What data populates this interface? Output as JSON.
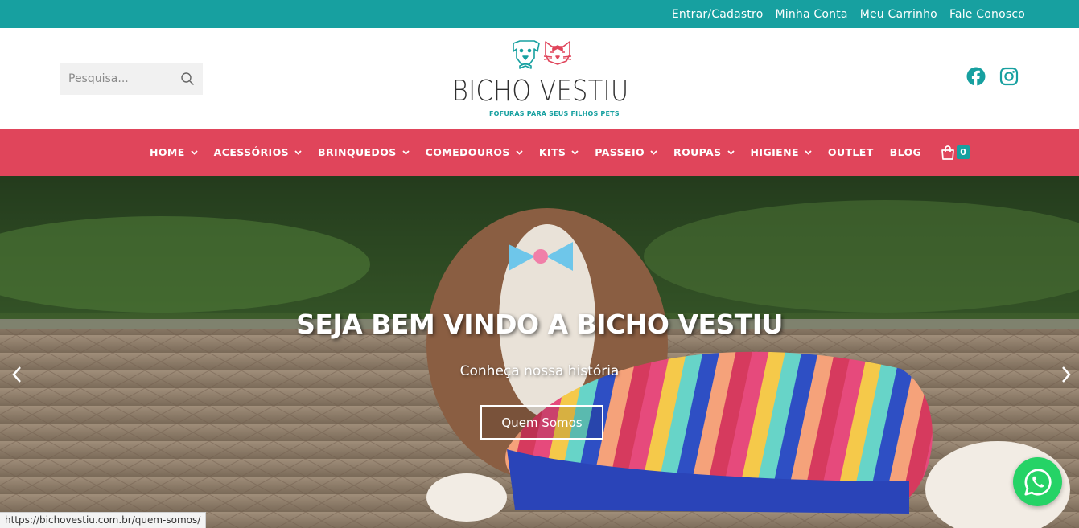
{
  "topbar": {
    "links": [
      "Entrar/Cadastro",
      "Minha Conta",
      "Meu Carrinho",
      "Fale Conosco"
    ],
    "color": "#17a0a0"
  },
  "header": {
    "search_placeholder": "Pesquisa...",
    "logo_brand": "BICHO VESTIU",
    "logo_tagline": "FOFURAS PARA SEUS FILHOS PETS",
    "social": [
      "facebook-icon",
      "instagram-icon"
    ]
  },
  "nav": {
    "color": "#e0455b",
    "items": [
      {
        "label": "HOME",
        "dropdown": true
      },
      {
        "label": "ACESSÓRIOS",
        "dropdown": true
      },
      {
        "label": "BRINQUEDOS",
        "dropdown": true
      },
      {
        "label": "COMEDOUROS",
        "dropdown": true
      },
      {
        "label": "KITS",
        "dropdown": true
      },
      {
        "label": "PASSEIO",
        "dropdown": true
      },
      {
        "label": "ROUPAS",
        "dropdown": true
      },
      {
        "label": "HIGIENE",
        "dropdown": true
      },
      {
        "label": "OUTLET",
        "dropdown": false
      },
      {
        "label": "BLOG",
        "dropdown": false
      }
    ],
    "cart_count": "0"
  },
  "hero": {
    "title": "SEJA BEM VINDO A BICHO VESTIU",
    "subtitle": "Conheça nossa história",
    "button": "Quem Somos"
  },
  "status_url": "https://bichovestiu.com.br/quem-somos/"
}
